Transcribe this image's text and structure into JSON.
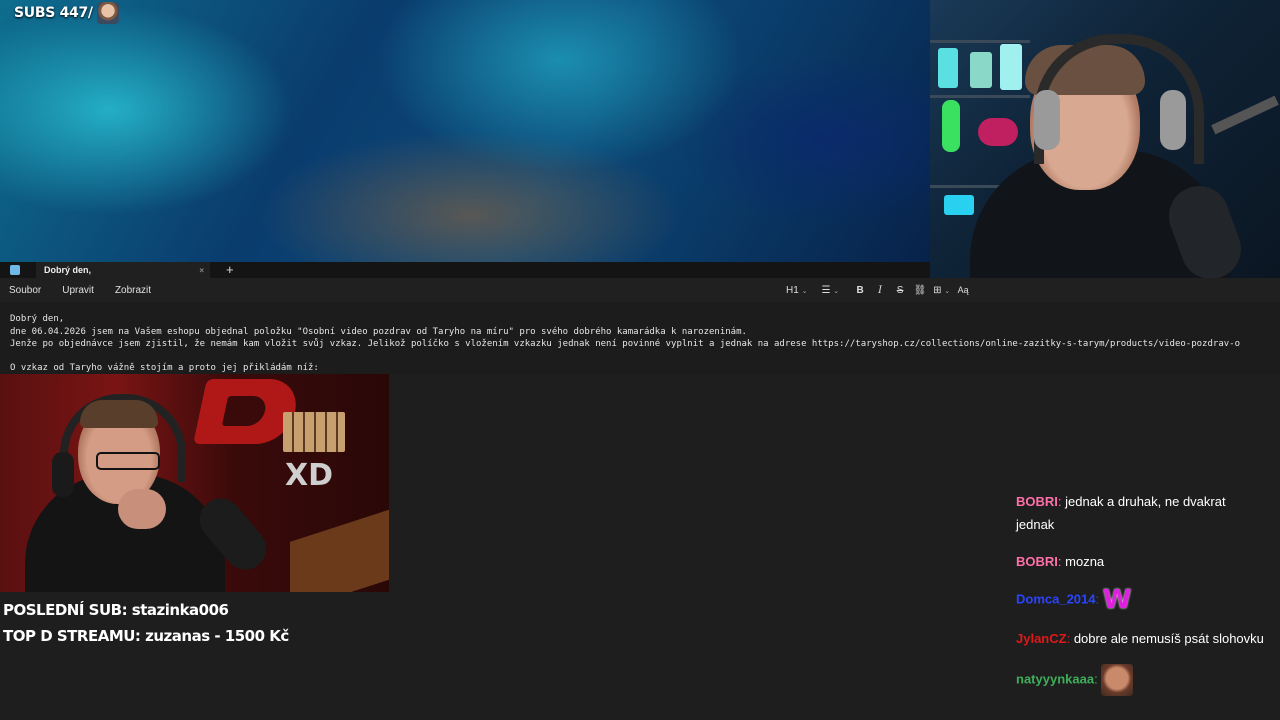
{
  "overlay": {
    "subs_label": "SUBS 447/",
    "last_sub": "POSLEDNÍ SUB: stazinka006",
    "top_donation": "TOP D STREAMU: zuzanas - 1500 Kč"
  },
  "editor": {
    "tab_title": "Dobrý den,",
    "tab_close": "×",
    "tab_add": "+",
    "menu": [
      "Soubor",
      "Upravit",
      "Zobrazit"
    ],
    "toolbar": {
      "heading": "H1",
      "list": "☰",
      "bold": "B",
      "italic": "I",
      "strike": "S",
      "link": "⛓",
      "table": "⊞",
      "spellcheck": "Aą",
      "chevron": "⌄"
    },
    "lines": [
      "Dobrý den,",
      "dne 06.04.2026 jsem na Vašem eshopu objednal položku \"Osobní video pozdrav od Taryho na míru\" pro svého dobrého kamarádka k narozeninám.",
      "Jenže po objednávce jsem zjistil, že nemám kam vložit svůj vzkaz. Jelikož políčko s vložením vzkazku jednak není povinné vyplnit a jednak na adrese https://taryshop.cz/collections/online-zazitky-s-tarym/products/video-pozdrav-o",
      "",
      "O vzkaz od Taryho vážně stojím a proto jej přikládám níž:"
    ]
  },
  "cam_bl": {
    "sign_text": "XD"
  },
  "chat": [
    {
      "user": "BOBRI",
      "color": "#ff6fa8",
      "text": "jednak a druhak, ne dvakrat jednak"
    },
    {
      "user": "BOBRI",
      "color": "#ff6fa8",
      "text": "mozna"
    },
    {
      "user": "Domca_2014",
      "color": "#2a44ff",
      "text": "",
      "emote": "W"
    },
    {
      "user": "JylanCZ",
      "color": "#e01818",
      "text": "dobre ale nemusíš psát slohovku"
    },
    {
      "user": "natyyynkaaa",
      "color": "#3fae5a",
      "text": "",
      "emote": "face"
    }
  ],
  "colors": {
    "wallpaper_accent": "#20b8d0",
    "editor_bg": "#1c1c1c"
  }
}
